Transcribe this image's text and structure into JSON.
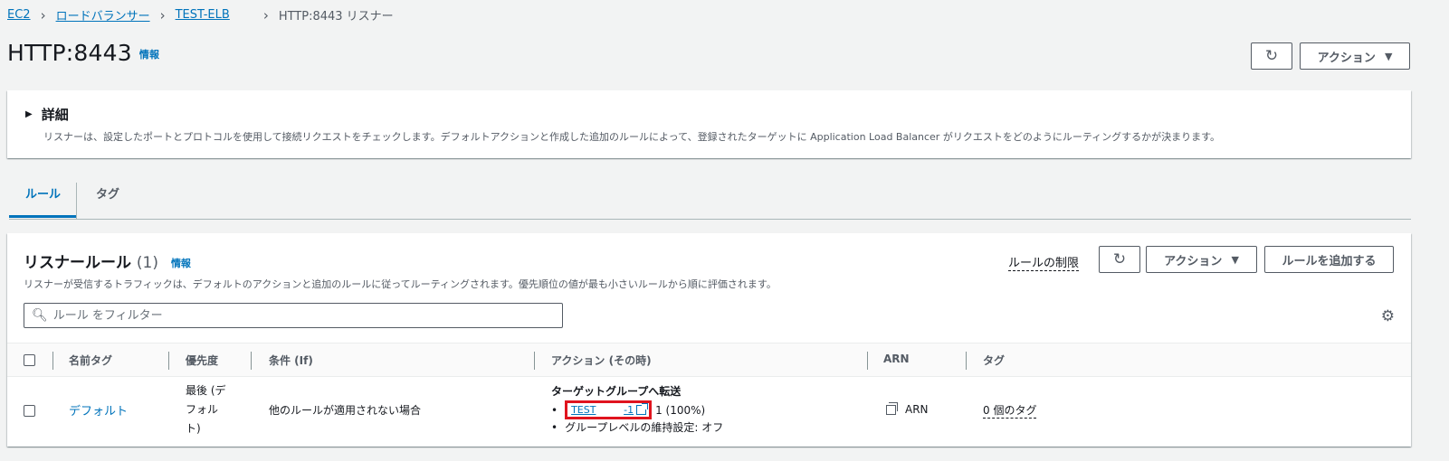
{
  "breadcrumb": {
    "items": [
      "EC2",
      "ロードバランサー",
      "TEST-ELB"
    ],
    "current": "HTTP:8443 リスナー"
  },
  "header": {
    "title": "HTTP:8443",
    "info": "情報",
    "actions_label": "アクション"
  },
  "details": {
    "title": "詳細",
    "description": "リスナーは、設定したポートとプロトコルを使用して接続リクエストをチェックします。デフォルトアクションと作成した追加のルールによって、登録されたターゲットに Application Load Balancer がリクエストをどのようにルーティングするかが決まります。"
  },
  "tabs": [
    {
      "label": "ルール",
      "active": true
    },
    {
      "label": "タグ",
      "active": false
    }
  ],
  "rules": {
    "title": "リスナールール",
    "count": "(1)",
    "info": "情報",
    "description": "リスナーが受信するトラフィックは、デフォルトのアクションと追加のルールに従ってルーティングされます。優先順位の値が最も小さいルールから順に評価されます。",
    "limit_link": "ルールの制限",
    "actions_label": "アクション",
    "add_rule_label": "ルールを追加する",
    "filter_placeholder": "ルール をフィルター",
    "columns": [
      "名前タグ",
      "優先度",
      "条件 (If)",
      "アクション (その時)",
      "ARN",
      "タグ"
    ],
    "rows": [
      {
        "name": "デフォルト",
        "priority_lines": [
          "最後 (デ",
          "フォル",
          "ト)"
        ],
        "condition": "他のルールが適用されない場合",
        "action_title": "ターゲットグループへ転送",
        "target_group_name": "TEST",
        "target_group_suffix": "-1",
        "target_weight": "1 (100%)",
        "stickiness": "グループレベルの維持設定: オフ",
        "arn": "ARN",
        "tags": "0 個のタグ"
      }
    ]
  },
  "colors": {
    "accent": "#0073bb",
    "highlight": "#e0141e",
    "background": "#f2f3f3"
  }
}
